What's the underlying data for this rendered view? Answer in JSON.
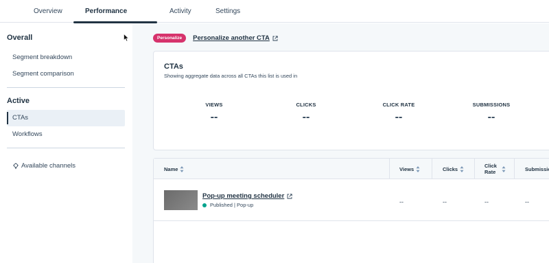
{
  "tabs": [
    {
      "label": "Overview"
    },
    {
      "label": "Performance"
    },
    {
      "label": "Activity"
    },
    {
      "label": "Settings"
    }
  ],
  "sidebar": {
    "overall_heading": "Overall",
    "overall_items": [
      {
        "label": "Segment breakdown"
      },
      {
        "label": "Segment comparison"
      }
    ],
    "active_heading": "Active",
    "active_items": [
      {
        "label": "CTAs"
      },
      {
        "label": "Workflows"
      }
    ],
    "channels_label": "Available channels"
  },
  "main": {
    "badge": "Personalize",
    "personalize_link": "Personalize another CTA",
    "card": {
      "title": "CTAs",
      "subtitle": "Showing aggregate data across all CTAs this list is used in",
      "metrics": [
        {
          "label": "VIEWS",
          "value": "--"
        },
        {
          "label": "CLICKS",
          "value": "--"
        },
        {
          "label": "CLICK RATE",
          "value": "--"
        },
        {
          "label": "SUBMISSIONS",
          "value": "--"
        }
      ]
    },
    "table": {
      "columns": [
        {
          "label": "Name"
        },
        {
          "label": "Views"
        },
        {
          "label": "Clicks"
        },
        {
          "label": "Click Rate"
        },
        {
          "label": "Submissio"
        }
      ],
      "rows": [
        {
          "name": "Pop-up meeting scheduler",
          "status": "Published | Pop-up",
          "views": "--",
          "clicks": "--",
          "click_rate": "--",
          "submissions": "--"
        }
      ]
    }
  },
  "colors": {
    "accent_badge": "#d6336c",
    "status_published": "#00a38d",
    "text_dark": "#213343"
  }
}
